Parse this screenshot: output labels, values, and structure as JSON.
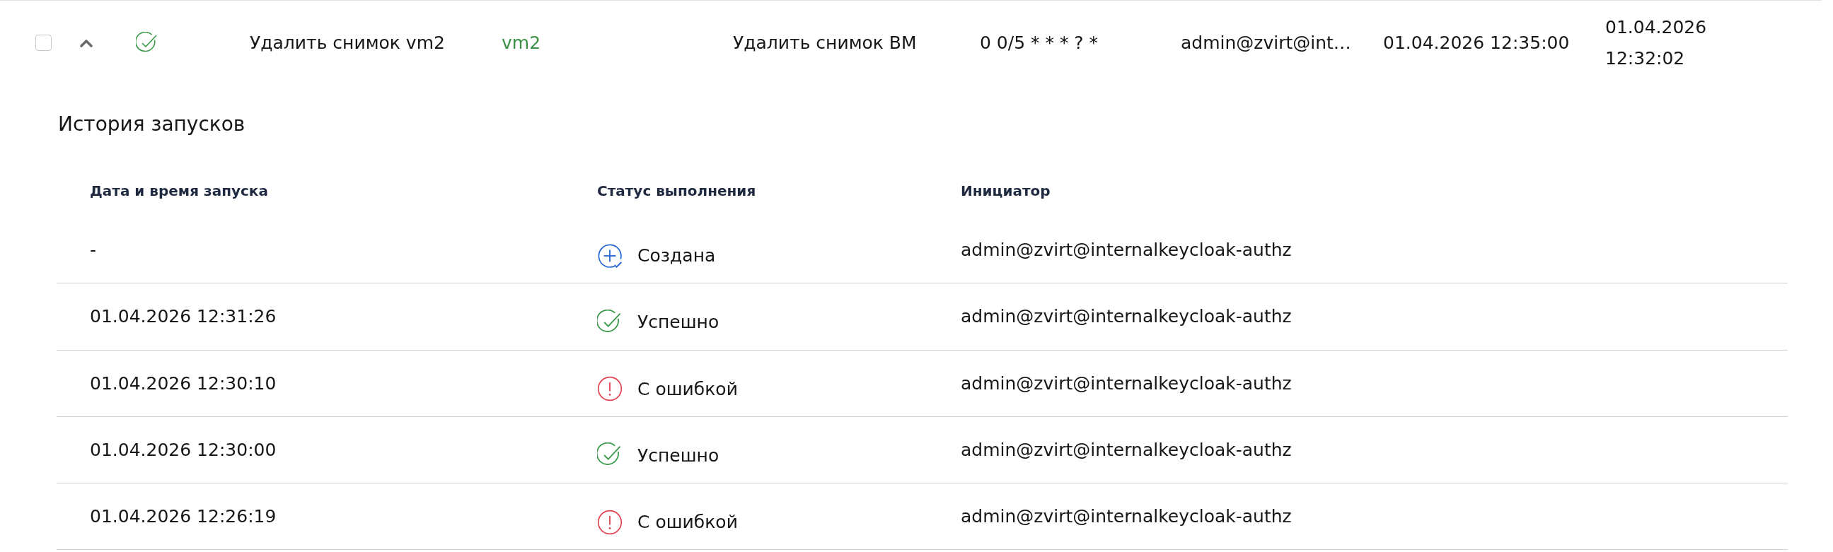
{
  "task": {
    "checked": false,
    "expanded": true,
    "status_icon": {
      "kind": "success"
    },
    "cells": [
      {
        "kind": "text",
        "text": "Удалить снимок vm2"
      },
      {
        "kind": "link",
        "text": "vm2"
      },
      {
        "kind": "text",
        "text": "Удалить снимок ВМ"
      },
      {
        "kind": "text",
        "text": "0 0/5 * * * ? *"
      },
      {
        "kind": "text",
        "text": "admin@zvirt@int…"
      },
      {
        "kind": "text",
        "text": "01.04.2026 12:35:00"
      },
      {
        "kind": "text",
        "text": "01.04.2026 12:32:02"
      }
    ]
  },
  "history": {
    "title": "История запусков",
    "columns": [
      "Дата и время запуска",
      "Статус выполнения",
      "Инициатор"
    ],
    "rows": [
      {
        "kind": "created",
        "started": "-",
        "status_label": "Создана",
        "initiator": "admin@zvirt@internalkeycloak-authz"
      },
      {
        "kind": "success",
        "started": "01.04.2026 12:31:26",
        "status_label": "Успешно",
        "initiator": "admin@zvirt@internalkeycloak-authz"
      },
      {
        "kind": "error",
        "started": "01.04.2026 12:30:10",
        "status_label": "С ошибкой",
        "initiator": "admin@zvirt@internalkeycloak-authz"
      },
      {
        "kind": "success",
        "started": "01.04.2026 12:30:00",
        "status_label": "Успешно",
        "initiator": "admin@zvirt@internalkeycloak-authz"
      },
      {
        "kind": "error",
        "started": "01.04.2026 12:26:19",
        "status_label": "С ошибкой",
        "initiator": "admin@zvirt@internalkeycloak-authz"
      }
    ]
  }
}
